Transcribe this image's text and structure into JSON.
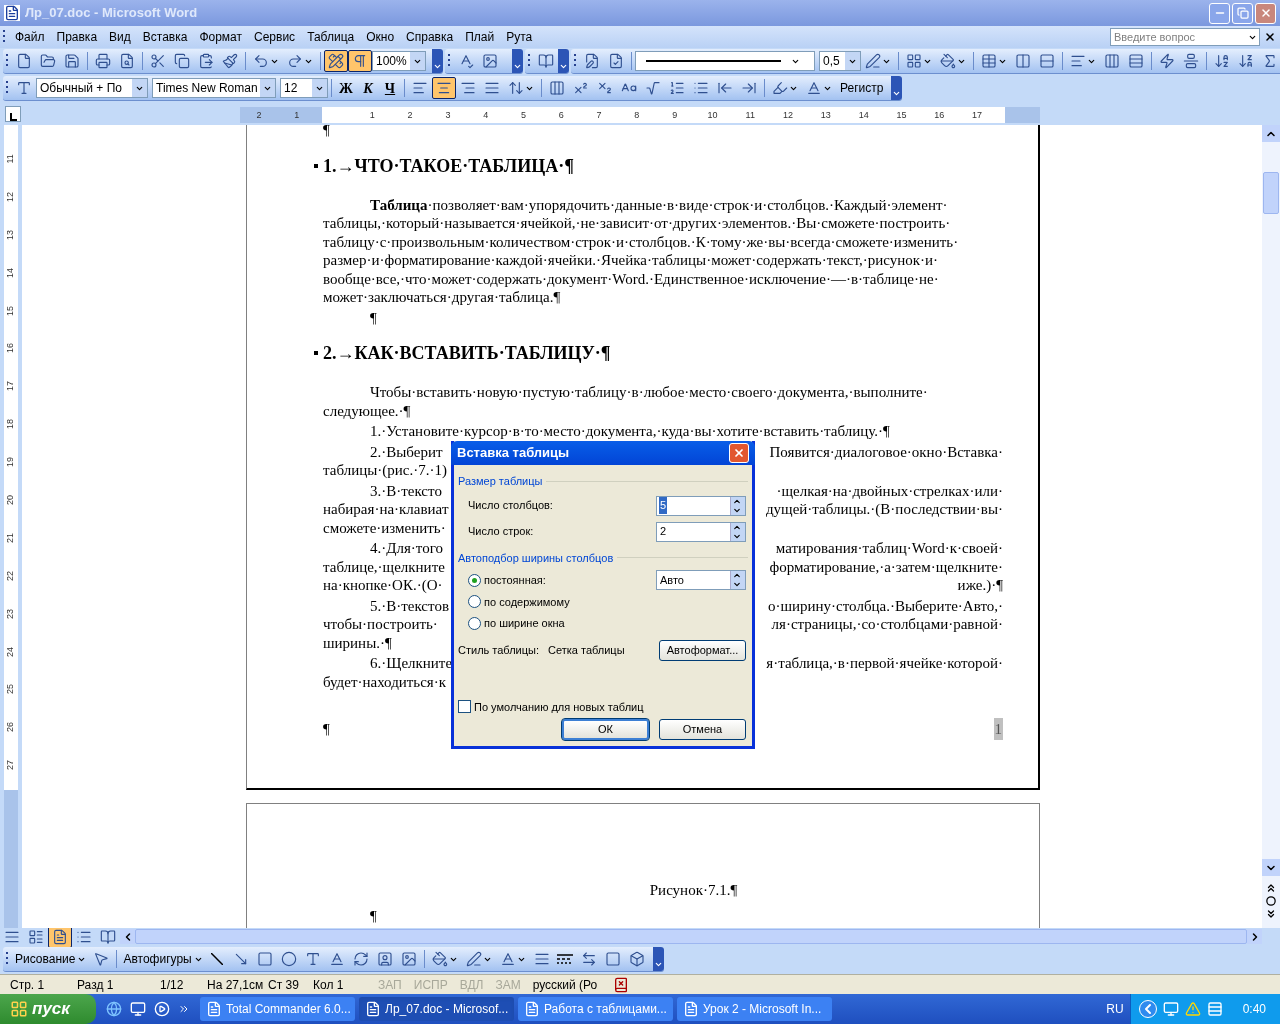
{
  "window": {
    "title": "Лр_07.doc - Microsoft Word"
  },
  "menu": [
    "Файл",
    "Правка",
    "Вид",
    "Вставка",
    "Формат",
    "Сервис",
    "Таблица",
    "Окно",
    "Справка",
    "Плай",
    "Рута"
  ],
  "help_box": {
    "placeholder": "Введите вопрос"
  },
  "standard_toolbar": {
    "toggles": [
      {
        "on": true
      },
      {
        "on": true
      }
    ],
    "zoom": "100%"
  },
  "tables_toolbar": {
    "line_weight": "0,5"
  },
  "formatting_toolbar": {
    "style": "Обычный + По",
    "font": "Times New Roman",
    "size": "12",
    "format_buttons": [
      "Ж",
      "К",
      "Ч"
    ],
    "alignment": [
      {
        "selected": false
      },
      {
        "selected": true
      },
      {
        "selected": false
      },
      {
        "selected": false
      }
    ],
    "change_case": "Регистр"
  },
  "ruler": {
    "horizontal": [
      "2",
      "1",
      "1",
      "2",
      "3",
      "4",
      "5",
      "6",
      "7",
      "8",
      "9",
      "10",
      "11",
      "12",
      "13",
      "14",
      "15",
      "16",
      "17"
    ],
    "vertical": [
      "11",
      "12",
      "13",
      "14",
      "15",
      "16",
      "17",
      "18",
      "19",
      "20",
      "21",
      "22",
      "23",
      "24",
      "25",
      "26",
      "27"
    ]
  },
  "page1": {
    "lines": [
      {
        "kind": "mark",
        "text": "¶"
      },
      {
        "kind": "heading",
        "text": "1.→ЧТО·ТАКОЕ·ТАБЛИЦА·¶"
      },
      {
        "kind": "first",
        "text": "**Таблица**·позволяет·вам·упорядочить·данные·в·виде·строк·и·столбцов.·Каждый·элемент·"
      },
      {
        "kind": "line",
        "text": "таблицы,·который·называется·ячейкой,·не·зависит·от·других·элементов.·Вы·сможете·построить·"
      },
      {
        "kind": "line",
        "text": "таблицу·с·произвольным·количеством·строк·и·столбцов.·К·тому·же·вы·всегда·сможете·изменить·"
      },
      {
        "kind": "line",
        "text": "размер·и·форматирование·каждой·ячейки.·Ячейка·таблицы·может·содержать·текст,·рисунок·и·"
      },
      {
        "kind": "line",
        "text": "вообще·все,·что·может·содержать·документ·Word.·Единственное·исключение·—·в·таблице·не·"
      },
      {
        "kind": "line",
        "text": "может·заключаться·другая·таблица.¶"
      },
      {
        "kind": "first",
        "text": "¶"
      },
      {
        "kind": "heading",
        "text": "2.→КАК·ВСТАВИТЬ·ТАБЛИЦУ·¶"
      },
      {
        "kind": "first",
        "text": "Чтобы·вставить·новую·пустую·таблицу·в·любое·место·своего·документа,·выполните·"
      },
      {
        "kind": "line",
        "text": "следующее.·¶"
      },
      {
        "kind": "first",
        "text": "1.·Установите·курсор·в·то·место·документа,·куда·вы·хотите·вставить·таблицу.·¶"
      },
      {
        "kind": "first_split",
        "left": "2.·Выберит",
        "right": "Появится·диалоговое·окно·Вставка·"
      },
      {
        "kind": "line",
        "text": "таблицы·(рис.·7.·1)"
      },
      {
        "kind": "first_split",
        "left": "3.·В·тексто",
        "right": "·щелкая·на·двойных·стрелках·или·"
      },
      {
        "kind": "split",
        "left": "набирая·на·клавиат",
        "right": "дущей·таблицы.·(В·последствии·вы·"
      },
      {
        "kind": "line",
        "text": "сможете·изменить·"
      },
      {
        "kind": "first_split",
        "left": "4.·Для·того",
        "right": "матирования·таблиц·Word·к·своей·"
      },
      {
        "kind": "split",
        "left": "таблице,·щелкните",
        "right": "форматирование,·а·затем·щелкните·"
      },
      {
        "kind": "split",
        "left": "на·кнопке·ОК.·(О·",
        "right": "иже.)·¶"
      },
      {
        "kind": "first_split",
        "left": "5.·В·текстов",
        "right": "о·ширину·столбца.·Выберите·Авто,·"
      },
      {
        "kind": "split",
        "left": "чтобы·построить·",
        "right": "ля·страницы,·со·столбцами·равной·"
      },
      {
        "kind": "line",
        "text": "ширины.·¶"
      },
      {
        "kind": "first_split",
        "left": "6.·Щелкните",
        "right": "я·таблица,·в·первой·ячейке·которой·"
      },
      {
        "kind": "line",
        "text": "будет·находиться·к"
      }
    ],
    "footer_mark": "¶",
    "page_number": "1"
  },
  "page2": {
    "caption": "Рисунок·7.1.¶",
    "mark": "¶"
  },
  "dialog": {
    "title": "Вставка таблицы",
    "size_group": "Размер таблицы",
    "fields": [
      {
        "label": "Число столбцов:",
        "value": "5"
      },
      {
        "label": "Число строк:",
        "value": "2"
      }
    ],
    "autofit_group": "Автоподбор ширины столбцов",
    "autofit": [
      {
        "label": "постоянная:",
        "selected": true
      },
      {
        "label": "по содержимому",
        "selected": false
      },
      {
        "label": "по ширине окна",
        "selected": false
      }
    ],
    "width_value": "Авто",
    "style_label": "Стиль таблицы:",
    "style_value": "Сетка таблицы",
    "autoformat": "Автоформат...",
    "default_checkbox": {
      "label": "По умолчанию для новых таблиц",
      "checked": false
    },
    "ok": "ОК",
    "cancel": "Отмена"
  },
  "view_buttons": [
    {
      "selected": false
    },
    {
      "selected": false
    },
    {
      "selected": true
    },
    {
      "selected": false
    },
    {
      "selected": false
    }
  ],
  "drawing_toolbar": {
    "draw": "Рисование",
    "autoshapes": "Автофигуры"
  },
  "status_bar": {
    "items": [
      "Стр. 1",
      "Разд 1",
      "1/12",
      "На 27,1см",
      "Ст 39",
      "Кол 1"
    ],
    "modes": [
      {
        "text": "ЗАП",
        "disabled": true
      },
      {
        "text": "ИСПР",
        "disabled": true
      },
      {
        "text": "ВДЛ",
        "disabled": true
      },
      {
        "text": "ЗАМ",
        "disabled": true
      }
    ],
    "language": "русский (Ро"
  },
  "taskbar": {
    "start": "пуск",
    "tasks": [
      {
        "label": "Total Commander 6.0...",
        "selected": false
      },
      {
        "label": "Лр_07.doc - Microsof...",
        "selected": true
      },
      {
        "label": "Работа с таблицами...",
        "selected": false
      },
      {
        "label": "Урок 2 - Microsoft In...",
        "selected": false
      }
    ],
    "language": "RU",
    "clock": "0:40"
  }
}
